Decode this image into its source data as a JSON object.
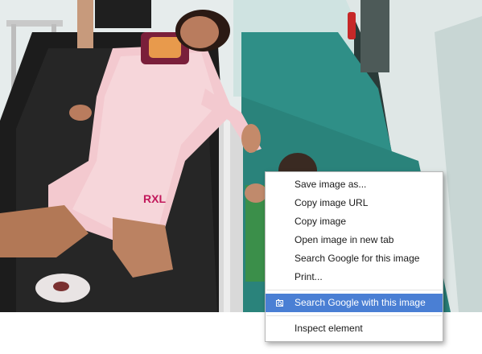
{
  "photo": {
    "description_icon": "hospital-corridor-photo",
    "floor_color": "#2f8f87",
    "stretcher_color": "#1c1c1c",
    "pajama_color": "#f3c9cf"
  },
  "context_menu": {
    "items": [
      {
        "label": "Save image as..."
      },
      {
        "label": "Copy image URL"
      },
      {
        "label": "Copy image"
      },
      {
        "label": "Open image in new tab"
      },
      {
        "label": "Search Google for this image"
      },
      {
        "label": "Print..."
      }
    ],
    "extension_item": {
      "label": "Search Google with this image",
      "icon": "search-by-image-icon"
    },
    "inspect_item": {
      "label": "Inspect element"
    },
    "highlight_color": "#4a7fd4"
  }
}
